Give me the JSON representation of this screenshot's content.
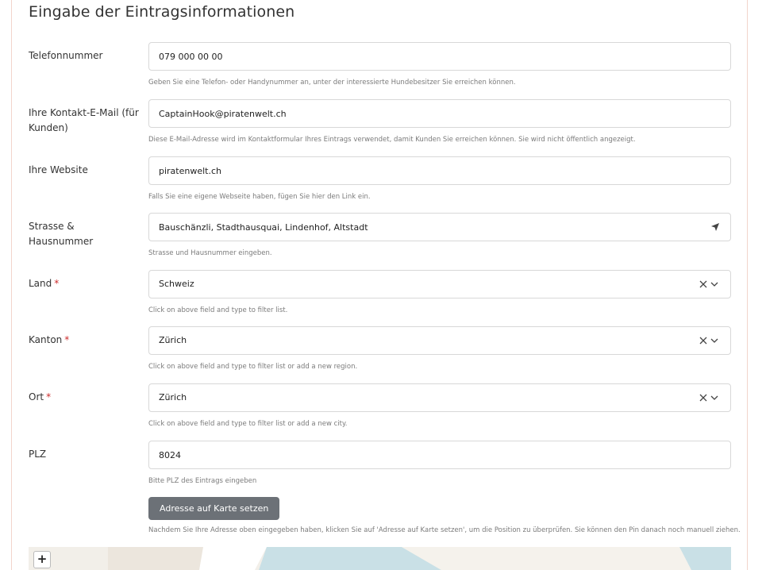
{
  "section": {
    "title": "Eingabe der Eintragsinformationen"
  },
  "fields": {
    "phone": {
      "label": "Telefonnummer",
      "value": "079 000 00 00",
      "help": "Geben Sie eine Telefon- oder Handynummer an, unter der interessierte Hundebesitzer Sie erreichen können."
    },
    "email": {
      "label": "Ihre Kontakt-E-Mail (für Kunden)",
      "value": "CaptainHook@piratenwelt.ch",
      "help": "Diese E-Mail-Adresse wird im Kontaktformular Ihres Eintrags verwendet, damit Kunden Sie erreichen können. Sie wird nicht öffentlich angezeigt."
    },
    "website": {
      "label": "Ihre Website",
      "value": "piratenwelt.ch",
      "help": "Falls Sie eine eigene Webseite haben, fügen Sie hier den Link ein."
    },
    "street": {
      "label": "Strasse & Hausnummer",
      "value": "Bauschänzli, Stadthausquai, Lindenhof, Altstadt",
      "help": "Strasse und Hausnummer eingeben.",
      "locate_icon": "location-arrow-icon"
    },
    "country": {
      "label": "Land",
      "required_mark": "*",
      "value": "Schweiz",
      "help": "Click on above field and type to filter list."
    },
    "canton": {
      "label": "Kanton",
      "required_mark": "*",
      "value": "Zürich",
      "help": "Click on above field and type to filter list or add a new region."
    },
    "city": {
      "label": "Ort",
      "required_mark": "*",
      "value": "Zürich",
      "help": "Click on above field and type to filter list or add a new city."
    },
    "zip": {
      "label": "PLZ",
      "value": "8024",
      "help": "Bitte PLZ des Eintrags eingeben"
    }
  },
  "map_action": {
    "button_label": "Adresse auf Karte setzen",
    "help": "Nachdem Sie Ihre Adresse oben eingegeben haben, klicken Sie auf 'Adresse auf Karte setzen', um die Position zu überprüfen. Sie können den Pin danach noch manuell ziehen."
  },
  "map": {
    "zoom_in_label": "+"
  },
  "colors": {
    "required": "#cc2b2b",
    "button_bg": "#6c7177",
    "border": "#d8d8d8",
    "water": "#c9e0e6"
  }
}
